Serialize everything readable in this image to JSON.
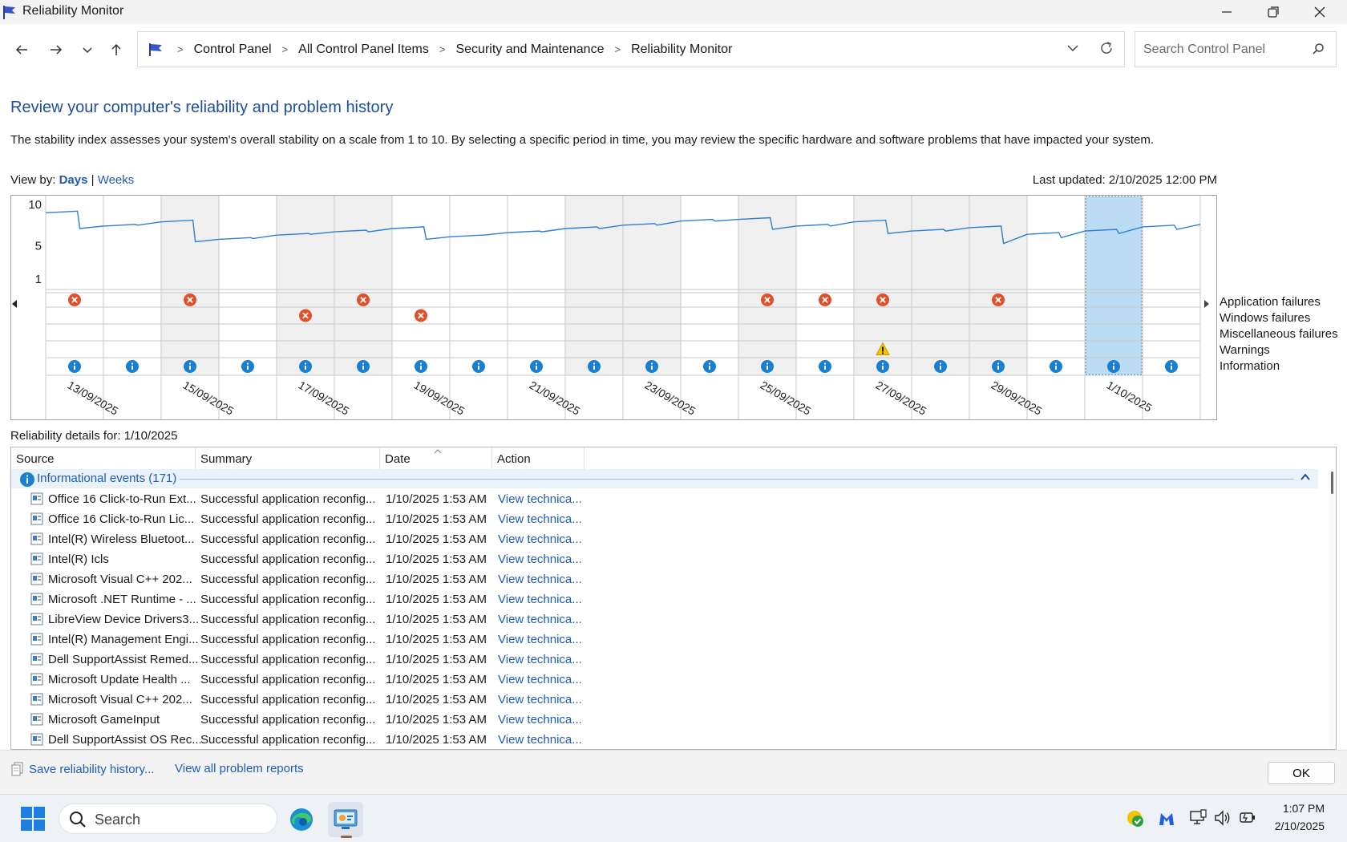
{
  "window": {
    "title": "Reliability Monitor"
  },
  "breadcrumbs": [
    "Control Panel",
    "All Control Panel Items",
    "Security and Maintenance",
    "Reliability Monitor"
  ],
  "search": {
    "placeholder": "Search Control Panel"
  },
  "page": {
    "heading": "Review your computer's reliability and problem history",
    "description": "The stability index assesses your system's overall stability on a scale from 1 to 10. By selecting a specific period in time, you may review the specific hardware and software problems that have impacted your system.",
    "view_by_label": "View by:",
    "view_days": "Days",
    "view_sep": "|",
    "view_weeks": "Weeks",
    "last_updated": "Last updated: 2/10/2025 12:00 PM"
  },
  "chart_data": {
    "type": "line",
    "y_ticks": [
      "10",
      "5",
      "1"
    ],
    "ylim": [
      1,
      10
    ],
    "date_labels": [
      "13/09/2025",
      "15/09/2025",
      "17/09/2025",
      "19/09/2025",
      "21/09/2025",
      "23/09/2025",
      "25/09/2025",
      "27/09/2025",
      "29/09/2025",
      "1/10/2025"
    ],
    "columns": [
      "13/09",
      "14/09",
      "15/09",
      "16/09",
      "17/09",
      "18/09",
      "19/09",
      "20/09",
      "21/09",
      "22/09",
      "23/09",
      "24/09",
      "25/09",
      "26/09",
      "27/09",
      "28/09",
      "29/09",
      "30/09",
      "1/10",
      "2/10"
    ],
    "selected_column": 18,
    "stability_index_start": 9.0,
    "stability_index_end": [
      7.4,
      7.9,
      5.8,
      6.3,
      6.7,
      7.1,
      6.1,
      6.6,
      7.1,
      7.5,
      8.0,
      8.2,
      7.4,
      7.9,
      6.8,
      7.2,
      6.4,
      6.8,
      7.3,
      7.6
    ],
    "stability_index_after_drop": [
      7.1,
      7.5,
      5.5,
      5.9,
      6.4,
      6.7,
      5.8,
      6.3,
      6.7,
      7.1,
      7.5,
      8.0,
      7.0,
      7.4,
      6.5,
      6.8,
      5.3,
      6.0,
      6.5,
      7.0
    ],
    "legend": [
      "Application failures",
      "Windows failures",
      "Miscellaneous failures",
      "Warnings",
      "Information"
    ],
    "application_failures": [
      0,
      2,
      5,
      12,
      13,
      14,
      16
    ],
    "windows_failures": [
      4,
      6
    ],
    "miscellaneous_failures": [],
    "warnings": [
      14
    ],
    "information": [
      0,
      1,
      2,
      3,
      4,
      5,
      6,
      7,
      8,
      9,
      10,
      11,
      12,
      13,
      14,
      15,
      16,
      17,
      18,
      19
    ]
  },
  "details": {
    "label": "Reliability details for: 1/10/2025",
    "columns": [
      "Source",
      "Summary",
      "Date",
      "Action"
    ],
    "group_label": "Informational events (171)",
    "rows": [
      {
        "source": "Office 16 Click-to-Run Ext...",
        "summary": "Successful application reconfig...",
        "date": "1/10/2025 1:53 AM",
        "action": "View technica..."
      },
      {
        "source": "Office 16 Click-to-Run Lic...",
        "summary": "Successful application reconfig...",
        "date": "1/10/2025 1:53 AM",
        "action": "View technica..."
      },
      {
        "source": "Intel(R) Wireless Bluetoot...",
        "summary": "Successful application reconfig...",
        "date": "1/10/2025 1:53 AM",
        "action": "View technica..."
      },
      {
        "source": "Intel(R) Icls",
        "summary": "Successful application reconfig...",
        "date": "1/10/2025 1:53 AM",
        "action": "View technica..."
      },
      {
        "source": "Microsoft Visual C++ 202...",
        "summary": "Successful application reconfig...",
        "date": "1/10/2025 1:53 AM",
        "action": "View technica..."
      },
      {
        "source": "Microsoft .NET Runtime - ...",
        "summary": "Successful application reconfig...",
        "date": "1/10/2025 1:53 AM",
        "action": "View technica..."
      },
      {
        "source": "LibreView Device Drivers3...",
        "summary": "Successful application reconfig...",
        "date": "1/10/2025 1:53 AM",
        "action": "View technica..."
      },
      {
        "source": "Intel(R) Management Engi...",
        "summary": "Successful application reconfig...",
        "date": "1/10/2025 1:53 AM",
        "action": "View technica..."
      },
      {
        "source": "Dell SupportAssist Remed...",
        "summary": "Successful application reconfig...",
        "date": "1/10/2025 1:53 AM",
        "action": "View technica..."
      },
      {
        "source": "Microsoft Update Health ...",
        "summary": "Successful application reconfig...",
        "date": "1/10/2025 1:53 AM",
        "action": "View technica..."
      },
      {
        "source": "Microsoft Visual C++ 202...",
        "summary": "Successful application reconfig...",
        "date": "1/10/2025 1:53 AM",
        "action": "View technica..."
      },
      {
        "source": "Microsoft GameInput",
        "summary": "Successful application reconfig...",
        "date": "1/10/2025 1:53 AM",
        "action": "View technica..."
      },
      {
        "source": "Dell SupportAssist OS Rec...",
        "summary": "Successful application reconfig...",
        "date": "1/10/2025 1:53 AM",
        "action": "View technica..."
      }
    ]
  },
  "footer": {
    "save_label": "Save reliability history...",
    "view_all_label": "View all problem reports",
    "ok_label": "OK"
  },
  "taskbar": {
    "search_label": "Search",
    "time": "1:07 PM",
    "date": "2/10/2025"
  },
  "colors": {
    "accent": "#1e5bb8",
    "heading": "#1e4e9e",
    "failure": "#e0502a",
    "info": "#1a7fd4",
    "warning": "#f5c400",
    "selected": "#bcdcf4",
    "shaded": "#f0f0f0"
  }
}
